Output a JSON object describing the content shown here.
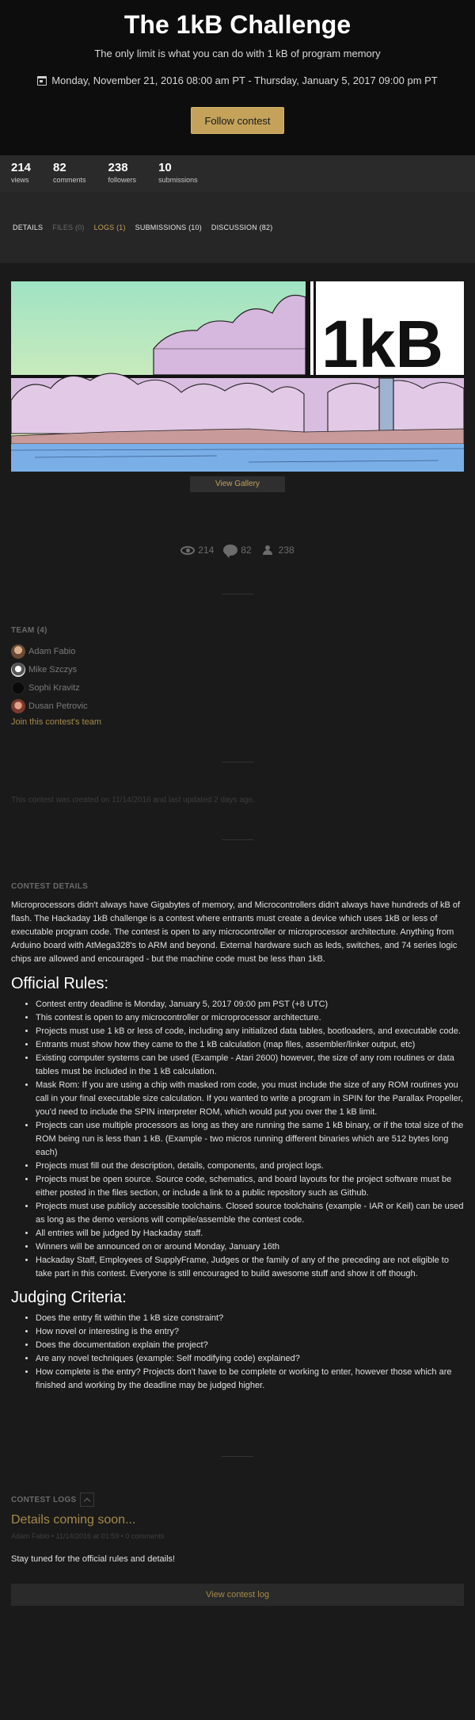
{
  "header": {
    "title": "The 1kB Challenge",
    "subtitle": "The only limit is what you can do with 1 kB of program memory",
    "dates": "Monday, November 21, 2016 08:00 am PT - Thursday, January 5, 2017 09:00 pm PT",
    "follow_label": "Follow contest"
  },
  "stats": [
    {
      "num": "214",
      "label": "views"
    },
    {
      "num": "82",
      "label": "comments"
    },
    {
      "num": "238",
      "label": "followers"
    },
    {
      "num": "10",
      "label": "submissions"
    }
  ],
  "tabs": [
    {
      "label": "DETAILS"
    },
    {
      "label": "FILES (0)"
    },
    {
      "label": "LOGS (1)"
    },
    {
      "label": "SUBMISSIONS (10)"
    },
    {
      "label": "DISCUSSION (82)"
    }
  ],
  "hero": {
    "logo_text": "1kB",
    "gallery_label": "View Gallery"
  },
  "counts": {
    "views": "214",
    "comments": "82",
    "followers": "238"
  },
  "team": {
    "heading": "TEAM (4)",
    "members": [
      {
        "name": "Adam Fabio"
      },
      {
        "name": "Mike Szczys"
      },
      {
        "name": "Sophi Kravitz"
      },
      {
        "name": "Dusan Petrovic"
      }
    ],
    "join_label": "Join this contest's team"
  },
  "created": "This contest was created on 11/14/2016 and last updated 2 days ago.",
  "details": {
    "heading": "CONTEST DETAILS",
    "intro": "Microprocessors didn't always have Gigabytes of memory, and Microcontrollers didn't always have hundreds of kB of flash. The Hackaday 1kB challenge is a contest where entrants must create a device which uses 1kB or less of executable program code. The contest is open to any microcontroller or microprocessor architecture. Anything from Arduino board with AtMega328's to ARM and beyond. External hardware such as leds, switches, and 74 series logic chips are allowed and encouraged - but the machine code must be less than 1kB.",
    "rules_heading": "Official Rules:",
    "rules": [
      "Contest entry deadline is Monday, January 5, 2017 09:00 pm PST (+8 UTC)",
      "This contest is open to any microcontroller or microprocessor architecture.",
      "Projects must use 1 kB or less of code, including any initialized data tables, bootloaders, and executable code.",
      "Entrants must show how they came to the 1 kB calculation (map files, assembler/linker output, etc)",
      "Existing computer systems can be used (Example - Atari 2600) however, the size of any rom routines or data tables must be included in the 1 kB calculation.",
      "Mask Rom: If you are using a chip with masked rom code, you must include the size of any ROM routines you call in your final executable size calculation. If you wanted to write a program in SPIN for the Parallax Propeller, you'd need to include the SPIN interpreter ROM, which would put you over the 1 kB limit.",
      "Projects can use multiple processors as long as they are running the same 1 kB binary, or if the total size of the ROM being run is less than 1 kB. (Example - two micros running different binaries which are 512 bytes long each)",
      "Projects must fill out the description, details, components, and project logs.",
      "Projects must be open source. Source code, schematics, and board layouts for the project software must be either posted in the files section, or include a link to a public repository such as Github.",
      "Projects must use publicly accessible toolchains. Closed source toolchains (example - IAR or Keil) can be used as long as the demo versions will compile/assemble the contest code.",
      "All entries will be judged by Hackaday staff.",
      "Winners will be announced on or around Monday, January 16th",
      "Hackaday Staff, Employees of SupplyFrame, Judges or the family of any of the preceding are not eligible to take part in this contest. Everyone is still encouraged to build awesome stuff and show it off though."
    ],
    "judging_heading": "Judging Criteria:",
    "judging": [
      "Does the entry fit within the 1 kB size constraint?",
      "How novel or interesting is the entry?",
      "Does the documentation explain the project?",
      "Are any novel techniques (example: Self modifying code) explained?",
      "How complete is the entry? Projects don't have to be complete or working to enter, however those which are finished and working by the deadline may be judged higher."
    ]
  },
  "logs": {
    "heading": "CONTEST LOGS",
    "title": "Details coming soon...",
    "meta": "Adam Fabio • 11/14/2016 at 01:59 • 0 comments",
    "body": "Stay tuned for the official rules and details!",
    "view_label": "View contest log"
  },
  "colors": {
    "accent": "#c4a25a",
    "background": "#1a1a1a",
    "header": "#0d0d0d"
  }
}
